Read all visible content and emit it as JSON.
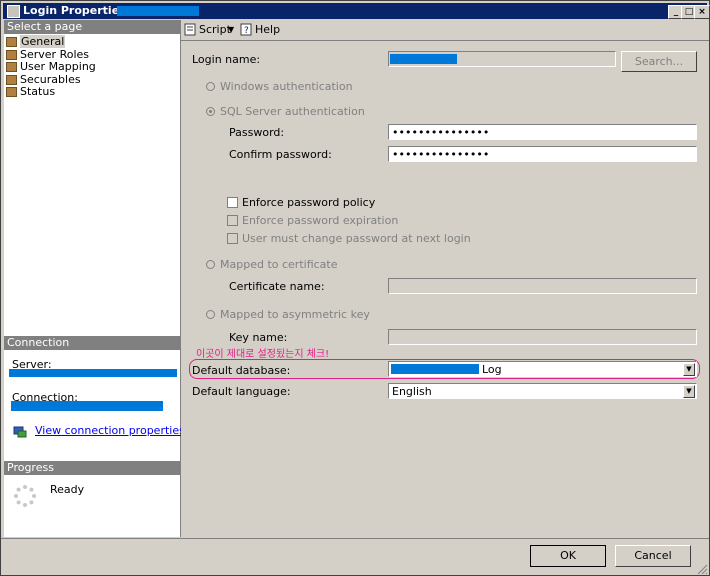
{
  "window": {
    "title": "Login Properties -"
  },
  "left": {
    "select_page_header": "Select a page",
    "pages": [
      {
        "label": "General",
        "icon": "page-icon"
      },
      {
        "label": "Server Roles",
        "icon": "page-icon"
      },
      {
        "label": "User Mapping",
        "icon": "page-icon"
      },
      {
        "label": "Securables",
        "icon": "page-icon"
      },
      {
        "label": "Status",
        "icon": "page-icon"
      }
    ],
    "connection_header": "Connection",
    "server_label": "Server:",
    "connection_label": "Connection:",
    "view_link": "View connection properties",
    "progress_header": "Progress",
    "progress_status": "Ready"
  },
  "toolbar": {
    "script_label": "Script",
    "help_label": "Help"
  },
  "general": {
    "login_name_label": "Login name:",
    "search_button": "Search...",
    "windows_auth": "Windows authentication",
    "sql_auth": "SQL Server authentication",
    "password_label": "Password:",
    "password_value": "•••••••••••••••",
    "confirm_label": "Confirm password:",
    "confirm_value": "•••••••••••••••",
    "enforce_policy": "Enforce password policy",
    "enforce_expiration": "Enforce password expiration",
    "must_change": "User must change password at next login",
    "mapped_cert": "Mapped to certificate",
    "cert_name_label": "Certificate name:",
    "mapped_asym": "Mapped to asymmetric key",
    "key_name_label": "Key name:",
    "annotation": "이곳이 제대로 설정됬는지 체크!",
    "default_db_label": "Default database:",
    "default_db_value": "Log",
    "default_lang_label": "Default language:",
    "default_lang_value": "English"
  },
  "buttons": {
    "ok": "OK",
    "cancel": "Cancel"
  },
  "colors": {
    "titlebar": "#0a246a",
    "annotation": "#e0218a",
    "redaction": "#0078d7"
  }
}
